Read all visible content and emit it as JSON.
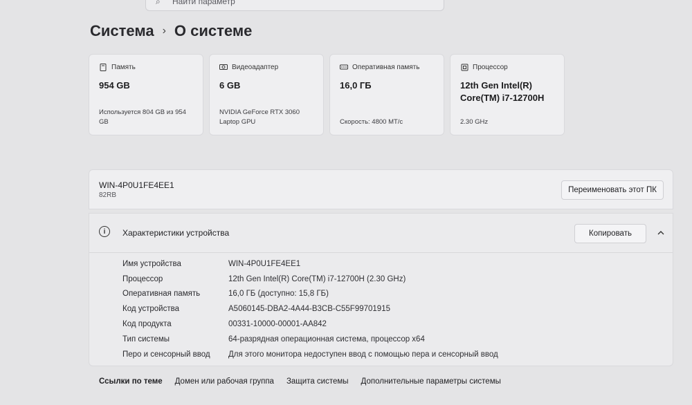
{
  "search": {
    "placeholder": "Найти параметр"
  },
  "breadcrumb": {
    "parent": "Система",
    "current": "О системе"
  },
  "cards": [
    {
      "icon": "storage-icon",
      "title": "Память",
      "value": "954 GB",
      "sub": "Используется 804 GB из 954 GB"
    },
    {
      "icon": "gpu-icon",
      "title": "Видеоадаптер",
      "value": "6 GB",
      "sub": "NVIDIA GeForce RTX 3060 Laptop GPU"
    },
    {
      "icon": "ram-icon",
      "title": "Оперативная память",
      "value": "16,0 ГБ",
      "sub": "Скорость: 4800 МТ/с"
    },
    {
      "icon": "cpu-icon",
      "title": "Процессор",
      "value": "12th Gen Intel(R) Core(TM) i7-12700H",
      "sub": "2.30 GHz"
    }
  ],
  "device": {
    "name": "WIN-4P0U1FE4EE1",
    "model": "82RB",
    "rename_label": "Переименовать этот ПК"
  },
  "specs": {
    "title": "Характеристики устройства",
    "copy_label": "Копировать",
    "rows": [
      {
        "key": "Имя устройства",
        "value": "WIN-4P0U1FE4EE1"
      },
      {
        "key": "Процессор",
        "value": "12th Gen Intel(R) Core(TM) i7-12700H (2.30 GHz)"
      },
      {
        "key": "Оперативная память",
        "value": "16,0 ГБ (доступно: 15,8 ГБ)"
      },
      {
        "key": "Код устройства",
        "value": "A5060145-DBA2-4A44-B3CB-C55F99701915"
      },
      {
        "key": "Код продукта",
        "value": "00331-10000-00001-AA842"
      },
      {
        "key": "Тип системы",
        "value": "64-разрядная операционная система, процессор x64"
      },
      {
        "key": "Перо и сенсорный ввод",
        "value": "Для этого монитора недоступен ввод с помощью пера и сенсорный ввод"
      }
    ]
  },
  "links": {
    "label": "Ссылки по теме",
    "items": [
      "Домен или рабочая группа",
      "Защита системы",
      "Дополнительные параметры системы"
    ]
  }
}
